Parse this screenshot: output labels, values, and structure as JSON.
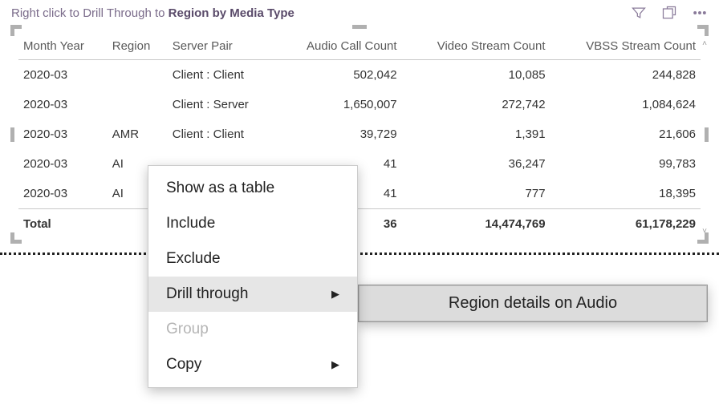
{
  "header": {
    "hint_prefix": "Right click to Drill Through to ",
    "hint_bold": "Region by Media Type"
  },
  "columns": {
    "month_year": "Month Year",
    "region": "Region",
    "server_pair": "Server Pair",
    "audio": "Audio Call Count",
    "video": "Video Stream Count",
    "vbss": "VBSS Stream Count"
  },
  "rows": [
    {
      "month_year": "2020-03",
      "region": "",
      "server_pair": "Client : Client",
      "audio": "502,042",
      "video": "10,085",
      "vbss": "244,828"
    },
    {
      "month_year": "2020-03",
      "region": "",
      "server_pair": "Client : Server",
      "audio": "1,650,007",
      "video": "272,742",
      "vbss": "1,084,624"
    },
    {
      "month_year": "2020-03",
      "region": "AMR",
      "server_pair": "Client : Client",
      "audio": "39,729",
      "video": "1,391",
      "vbss": "21,606"
    },
    {
      "month_year": "2020-03",
      "region": "AI",
      "server_pair": "",
      "audio": "41",
      "video": "36,247",
      "vbss": "99,783"
    },
    {
      "month_year": "2020-03",
      "region": "AI",
      "server_pair": "",
      "audio": "41",
      "video": "777",
      "vbss": "18,395"
    }
  ],
  "total": {
    "label": "Total",
    "audio": "36",
    "video": "14,474,769",
    "vbss": "61,178,229"
  },
  "context_menu": {
    "show_table": "Show as a table",
    "include": "Include",
    "exclude": "Exclude",
    "drill_through": "Drill through",
    "group": "Group",
    "copy": "Copy"
  },
  "submenu": {
    "region_audio": "Region details on Audio"
  },
  "chart_data": {
    "type": "table",
    "title": "Region by Media Type",
    "columns": [
      "Month Year",
      "Region",
      "Server Pair",
      "Audio Call Count",
      "Video Stream Count",
      "VBSS Stream Count"
    ],
    "rows": [
      [
        "2020-03",
        "",
        "Client : Client",
        502042,
        10085,
        244828
      ],
      [
        "2020-03",
        "",
        "Client : Server",
        1650007,
        272742,
        1084624
      ],
      [
        "2020-03",
        "AMR",
        "Client : Client",
        39729,
        1391,
        21606
      ],
      [
        "2020-03",
        "AI",
        "",
        41,
        36247,
        99783
      ],
      [
        "2020-03",
        "AI",
        "",
        41,
        777,
        18395
      ]
    ],
    "total": {
      "Audio Call Count": 36,
      "Video Stream Count": 14474769,
      "VBSS Stream Count": 61178229
    }
  }
}
